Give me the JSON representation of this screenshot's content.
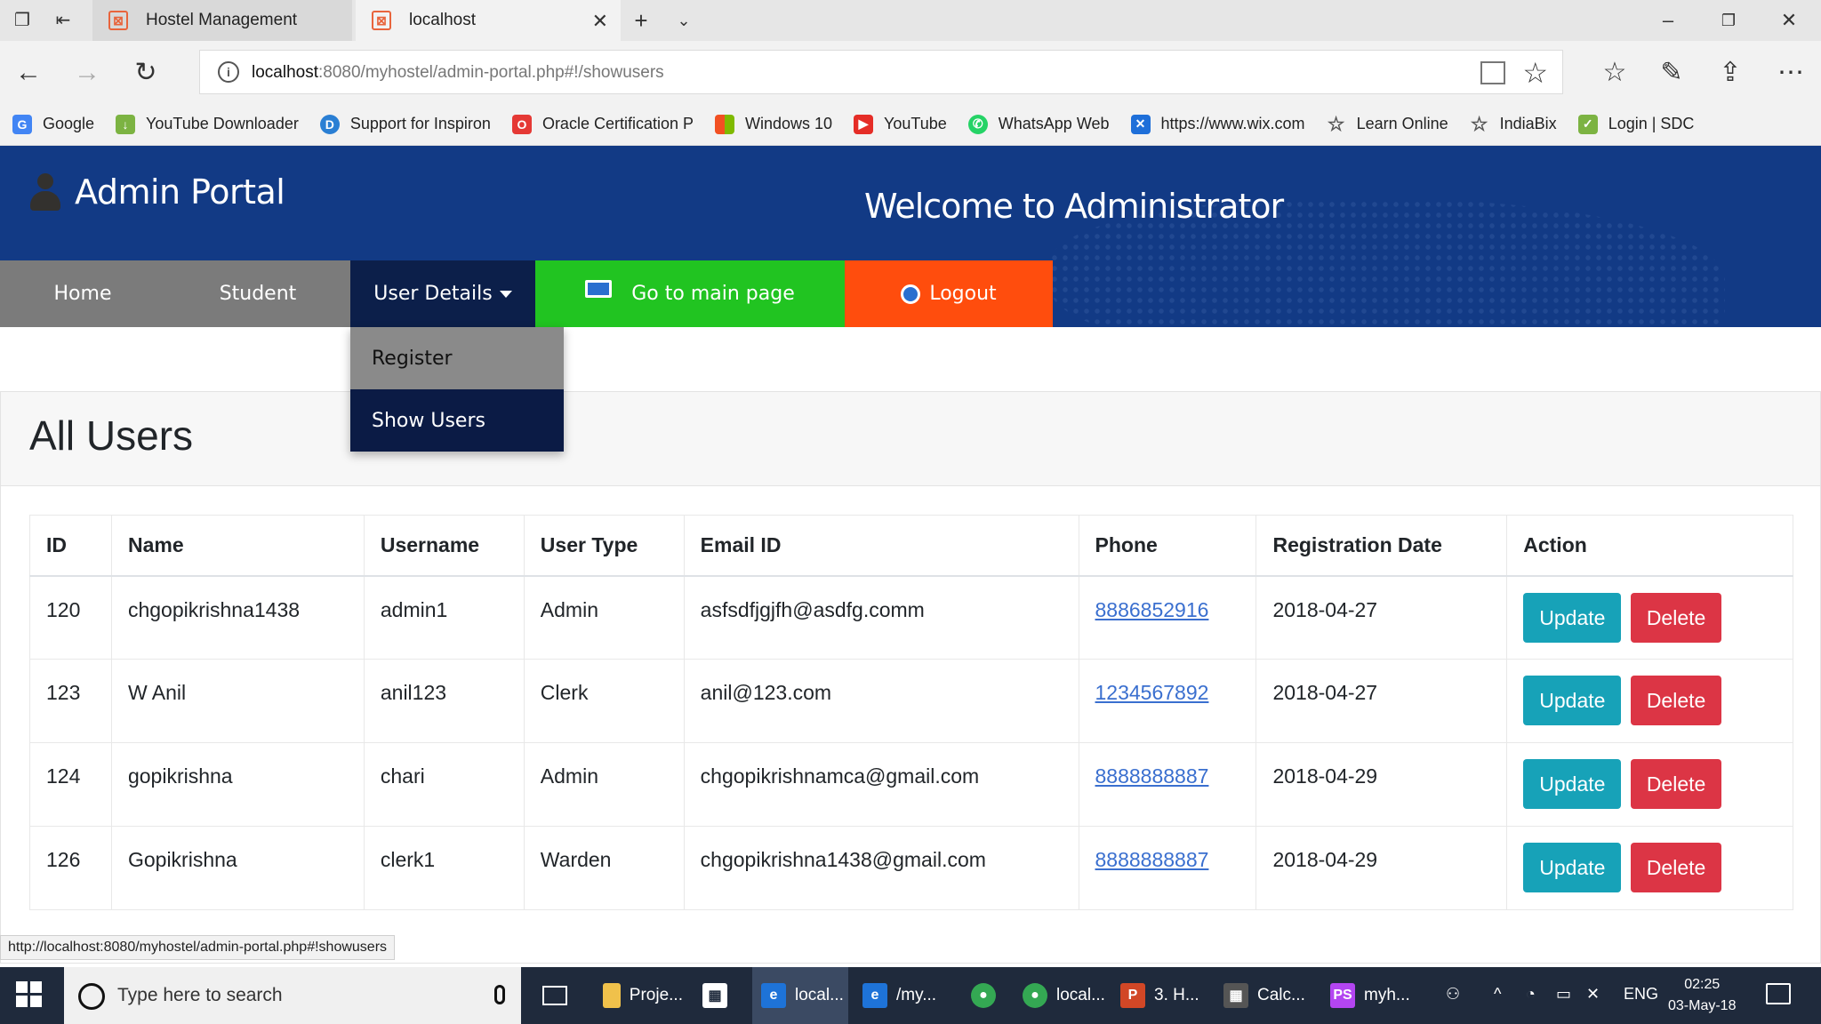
{
  "browser": {
    "tabs": [
      {
        "label": "Hostel Management"
      },
      {
        "label": "localhost"
      }
    ],
    "url_host": "localhost",
    "url_rest": ":8080/myhostel/admin-portal.php#!/showusers",
    "favorites": [
      {
        "label": "Google",
        "icon": "google-icon",
        "color": "#4285f4"
      },
      {
        "label": "YouTube Downloader",
        "icon": "download-icon",
        "color": "#7cb342"
      },
      {
        "label": "Support for Inspiron",
        "icon": "dell-icon",
        "color": "#2a7fd4"
      },
      {
        "label": "Oracle Certification P",
        "icon": "oracle-icon",
        "color": "#e53935"
      },
      {
        "label": "Windows 10",
        "icon": "windows-icon",
        "color": "#f25022"
      },
      {
        "label": "YouTube",
        "icon": "youtube-icon",
        "color": "#e52d27"
      },
      {
        "label": "WhatsApp Web",
        "icon": "whatsapp-icon",
        "color": "#25d366"
      },
      {
        "label": "https://www.wix.com",
        "icon": "wix-icon",
        "color": "#1e6fd9"
      },
      {
        "label": "Learn Online",
        "icon": "star-icon",
        "color": "#555555"
      },
      {
        "label": "IndiaBix",
        "icon": "star-icon",
        "color": "#555555"
      },
      {
        "label": "Login | SDC",
        "icon": "sdc-icon",
        "color": "#7cb342"
      }
    ],
    "status_url": "http://localhost:8080/myhostel/admin-portal.php#!showusers"
  },
  "header": {
    "brand_title": "Admin Portal",
    "welcome": "Welcome to Administrator"
  },
  "menu": {
    "home": "Home",
    "student": "Student",
    "user_details": "User Details",
    "main_page": "Go to main page",
    "logout": "Logout"
  },
  "dropdown": {
    "register": "Register",
    "show_users": "Show Users"
  },
  "content": {
    "title": "All Users",
    "columns": [
      "ID",
      "Name",
      "Username",
      "User Type",
      "Email ID",
      "Phone",
      "Registration Date",
      "Action"
    ],
    "rows": [
      {
        "id": "120",
        "name": "chgopikrishna1438",
        "username": "admin1",
        "type": "Admin",
        "email": "asfsdfjgjfh@asdfg.comm",
        "phone": "8886852916",
        "date": "2018-04-27"
      },
      {
        "id": "123",
        "name": "W Anil",
        "username": "anil123",
        "type": "Clerk",
        "email": "anil@123.com",
        "phone": "1234567892",
        "date": "2018-04-27"
      },
      {
        "id": "124",
        "name": "gopikrishna",
        "username": "chari",
        "type": "Admin",
        "email": "chgopikrishnamca@gmail.com",
        "phone": "8888888887",
        "date": "2018-04-29"
      },
      {
        "id": "126",
        "name": "Gopikrishna",
        "username": "clerk1",
        "type": "Warden",
        "email": "chgopikrishna1438@gmail.com",
        "phone": "8888888887",
        "date": "2018-04-29"
      }
    ],
    "update_label": "Update",
    "delete_label": "Delete"
  },
  "taskbar": {
    "search_placeholder": "Type here to search",
    "items": [
      {
        "label": "Proje...",
        "icon": "folder-icon",
        "color": "#f0c14b"
      },
      {
        "label": "local...",
        "icon": "edge-icon",
        "color": "#1e73d8"
      },
      {
        "label": "/my...",
        "icon": "edge-icon",
        "color": "#1e73d8"
      },
      {
        "label": "local...",
        "icon": "chrome-icon",
        "color": "#34a853"
      },
      {
        "label": "3. H...",
        "icon": "powerpoint-icon",
        "color": "#d24726"
      },
      {
        "label": "Calc...",
        "icon": "calculator-icon",
        "color": "#555555"
      },
      {
        "label": "myh...",
        "icon": "phpstorm-icon",
        "color": "#b345f1"
      }
    ],
    "lang": "ENG",
    "time": "02:25",
    "date": "03-May-18"
  }
}
